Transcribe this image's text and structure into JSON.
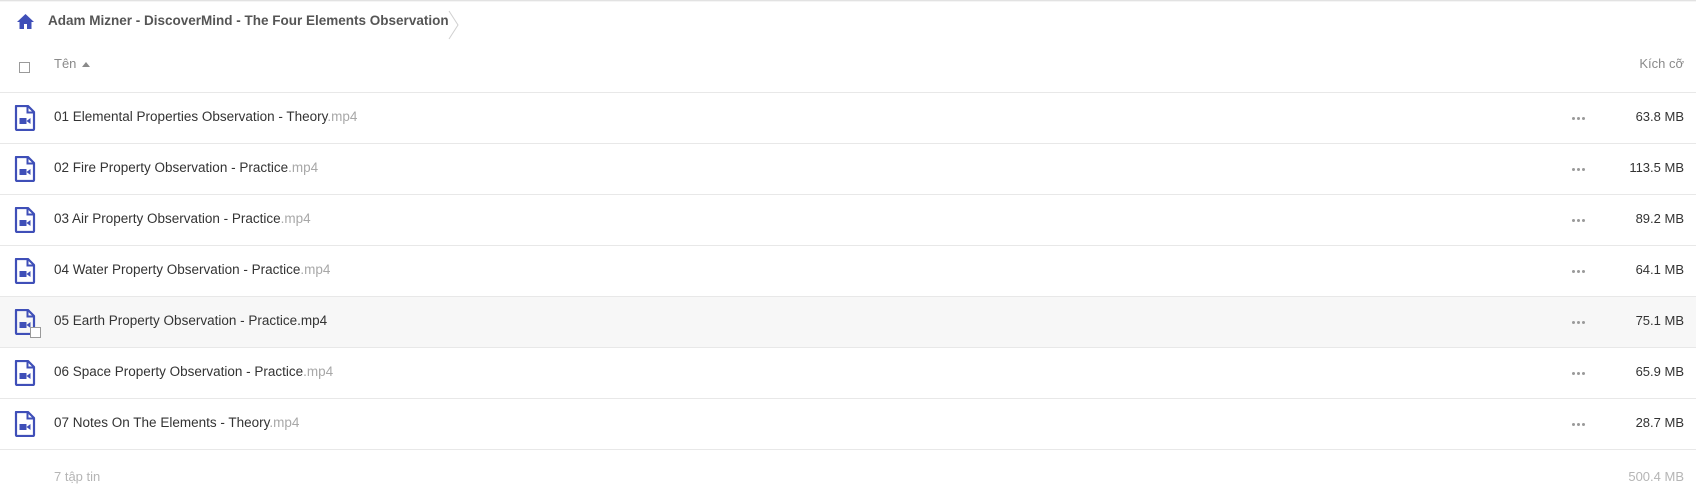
{
  "breadcrumb": {
    "home_icon": "home-icon",
    "folder": "Adam Mizner - DiscoverMind - The Four Elements Observation"
  },
  "table": {
    "col_name": "Tên",
    "col_size": "Kích cỡ",
    "sort": "ascending",
    "files": [
      {
        "name": "01 Elemental Properties Observation - Theory",
        "ext": ".mp4",
        "size": "63.8 MB"
      },
      {
        "name": "02 Fire Property Observation - Practice",
        "ext": ".mp4",
        "size": "113.5 MB"
      },
      {
        "name": "03 Air Property Observation - Practice",
        "ext": ".mp4",
        "size": "89.2 MB"
      },
      {
        "name": "04 Water Property Observation - Practice",
        "ext": ".mp4",
        "size": "64.1 MB"
      },
      {
        "name": "05 Earth Property Observation - Practice",
        "ext": ".mp4",
        "size": "75.1 MB"
      },
      {
        "name": "06 Space Property Observation - Practice",
        "ext": ".mp4",
        "size": "65.9 MB"
      },
      {
        "name": "07 Notes On The Elements - Theory",
        "ext": ".mp4",
        "size": "28.7 MB"
      }
    ],
    "hovered_index": 4
  },
  "footer": {
    "count": "7 tập tin",
    "total": "500.4 MB"
  },
  "colors": {
    "icon": "#3f4fb8",
    "text": "#333333",
    "muted": "#a8a8a8",
    "hover_row": "#f7f7f7"
  }
}
